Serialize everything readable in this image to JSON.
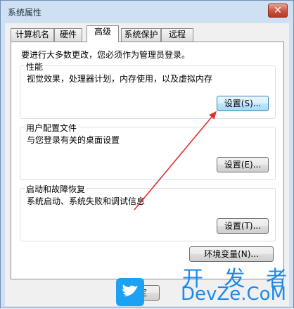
{
  "window": {
    "title": "系统属性",
    "close_label": "✕"
  },
  "tabs": [
    {
      "label": "计算机名"
    },
    {
      "label": "硬件"
    },
    {
      "label": "高级",
      "active": true
    },
    {
      "label": "系统保护"
    },
    {
      "label": "远程"
    }
  ],
  "panel": {
    "admin_notice": "要进行大多数更改，您必须作为管理员登录。",
    "performance": {
      "title": "性能",
      "description": "视觉效果，处理器计划，内存使用，以及虚拟内存",
      "button": "设置(S)..."
    },
    "user_profiles": {
      "title": "用户配置文件",
      "description": "与您登录有关的桌面设置",
      "button": "设置(E)..."
    },
    "startup_recovery": {
      "title": "启动和故障恢复",
      "description": "系统启动、系统失败和调试信息",
      "button": "设置(T)..."
    },
    "env_button": "环境变量(N)..."
  },
  "footer": {
    "ok_button": "确定"
  },
  "watermark": {
    "top": "开 发 者",
    "bottom": "DevZe.CoM"
  },
  "colors": {
    "arrow": "#e03030",
    "accent": "#3c7fb1",
    "watermark": "#1d8ae8"
  },
  "icons": {
    "close": "close-icon",
    "logo": "bird-logo-icon"
  }
}
